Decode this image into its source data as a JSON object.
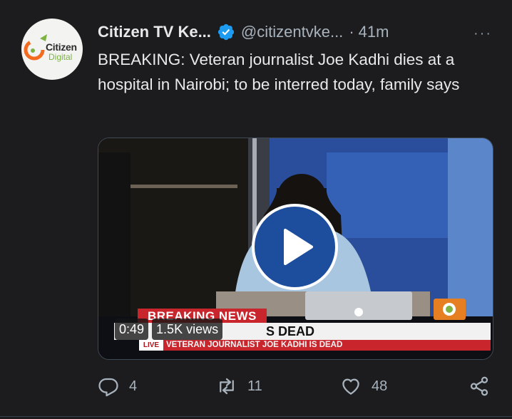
{
  "tweet": {
    "avatar": {
      "brand_line1": "Citizen",
      "brand_line2": "Digital"
    },
    "display_name": "Citizen TV Ke...",
    "handle": "@citizentvke...",
    "separator": "·",
    "time": "41m",
    "more_label": "···",
    "text": "BREAKING: Veteran journalist Joe Kadhi dies at a hospital in Nairobi; to be interred today, family says",
    "media": {
      "type": "video",
      "duration": "0:49",
      "views": "1.5K views",
      "overlay": {
        "breaking_label": "BREAKING NEWS",
        "headline": "S DEAD",
        "live_label": "LIVE",
        "ticker": "VETERAN JOURNALIST JOE KADHI IS DEAD"
      }
    },
    "actions": {
      "replies": "4",
      "retweets": "11",
      "likes": "48"
    }
  },
  "colors": {
    "background": "#1c1c1e",
    "verified_badge": "#1d9bf0",
    "play_button": "#1d4e9d",
    "breaking_red": "#c9252c",
    "muted_text": "#a8b3bd"
  },
  "icons": {
    "verified": "verified-badge-icon",
    "reply": "reply-icon",
    "retweet": "retweet-icon",
    "like": "heart-icon",
    "share": "share-icon",
    "play": "play-icon",
    "more": "more-icon"
  }
}
